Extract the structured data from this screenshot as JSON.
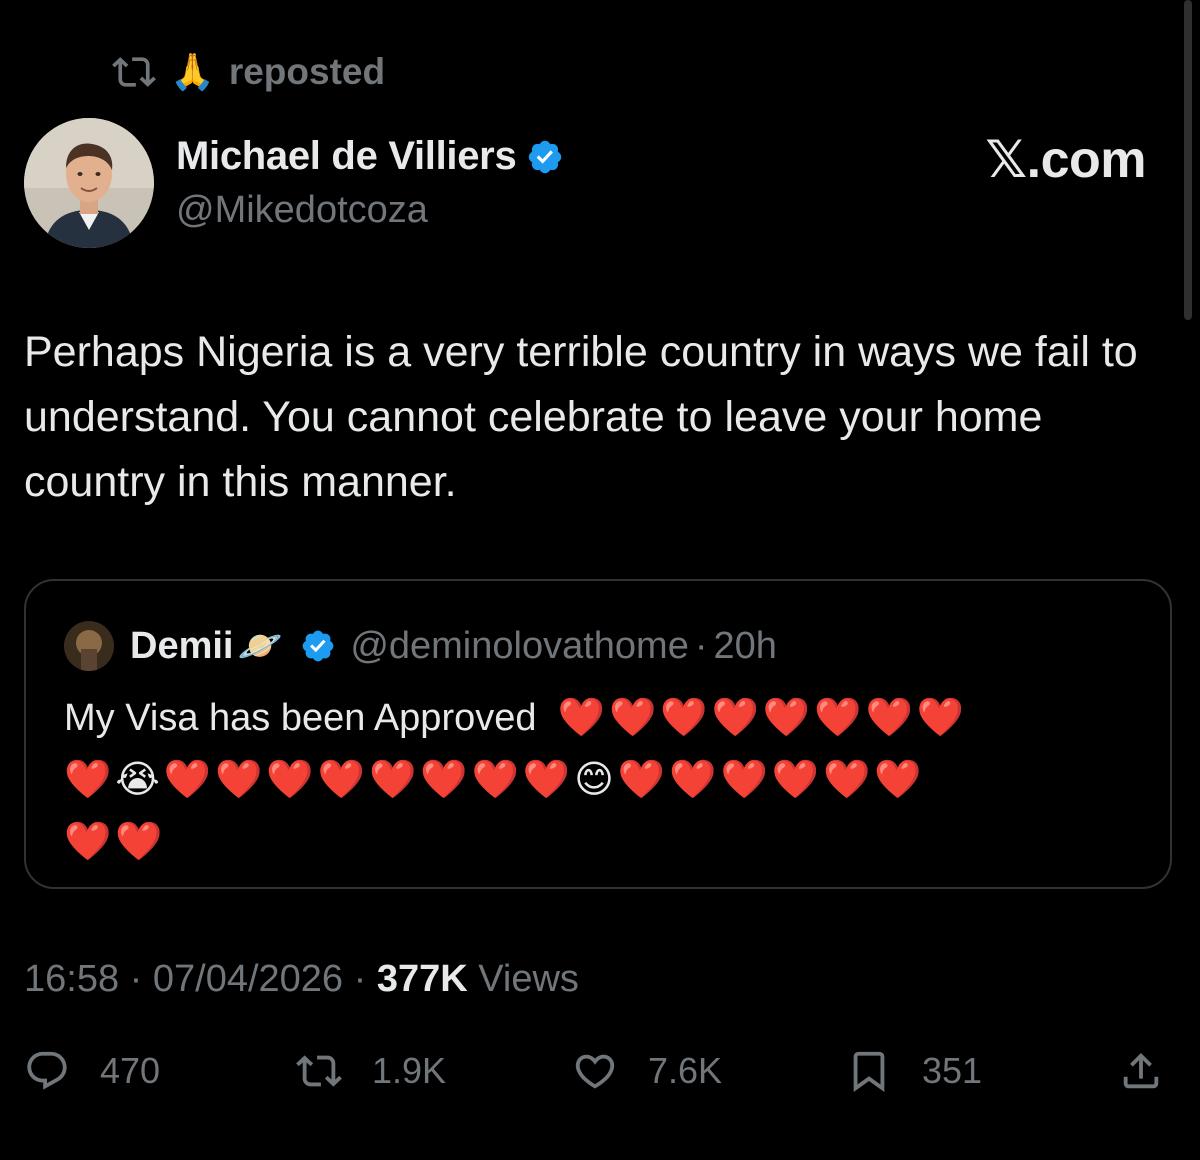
{
  "repost": {
    "emoji": "🙏",
    "label": "reposted"
  },
  "author": {
    "display_name": "Michael de Villiers",
    "handle": "@Mikedotcoza",
    "avatar_icon": "profile-photo"
  },
  "site_label": "𝕏.com",
  "tweet": {
    "text": "Perhaps Nigeria is a very terrible country in ways we fail to understand. You cannot celebrate to leave your home country in this manner."
  },
  "quote": {
    "display_name": "Demii",
    "name_emoji": "🪐",
    "handle": "@deminolovathome",
    "separator": "·",
    "time": "20h",
    "text_prefix": "My Visa has been Approved",
    "emoji_line1": "❤️❤️❤️❤️❤️❤️❤️❤️",
    "emoji_line2": "❤️😭❤️❤️❤️❤️❤️❤️❤️❤️😊❤️❤️❤️❤️❤️❤️",
    "emoji_line3": "❤️❤️"
  },
  "meta": {
    "time": "16:58",
    "separator": "·",
    "date": "07/04/2026",
    "views_count": "377K",
    "views_label": "Views"
  },
  "actions": {
    "replies": "470",
    "reposts": "1.9K",
    "likes": "7.6K",
    "bookmarks": "351"
  },
  "colors": {
    "background": "#000000",
    "text": "#e7e9ea",
    "muted": "#71767b",
    "verified": "#1d9bf0",
    "border": "#2f3336"
  }
}
